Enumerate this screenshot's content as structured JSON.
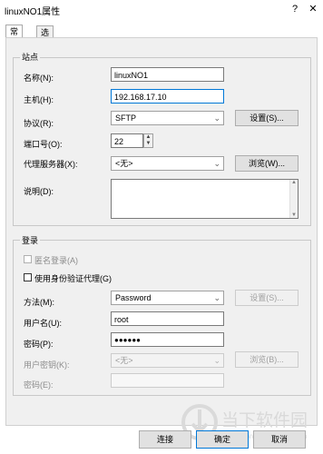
{
  "window": {
    "title": "linuxNO1属性",
    "help_glyph": "?",
    "close_glyph": "✕"
  },
  "tabs": [
    {
      "label": "常规"
    },
    {
      "label": "选项"
    }
  ],
  "station": {
    "group_title": "站点",
    "name_label": "名称(N):",
    "name_value": "linuxNO1",
    "host_label": "主机(H):",
    "host_value": "192.168.17.10",
    "protocol_label": "协议(R):",
    "protocol_value": "SFTP",
    "protocol_settings_button": "设置(S)...",
    "port_label": "端口号(O):",
    "port_value": "22",
    "proxy_label": "代理服务器(X):",
    "proxy_value": "<无>",
    "proxy_browse_button": "浏览(W)...",
    "description_label": "说明(D):",
    "description_value": ""
  },
  "login": {
    "group_title": "登录",
    "anonymous_label": "匿名登录(A)",
    "agent_label": "使用身份验证代理(G)",
    "method_label": "方法(M):",
    "method_value": "Password",
    "method_settings_button": "设置(S)...",
    "username_label": "用户名(U):",
    "username_value": "root",
    "password_label": "密码(P):",
    "password_value": "●●●●●●",
    "userkey_label": "用户密钥(K):",
    "userkey_value": "<无>",
    "userkey_browse_button": "浏览(B)...",
    "passphrase_label": "密码(E):",
    "passphrase_value": ""
  },
  "footer": {
    "connect_button": "连接",
    "ok_button": "确定",
    "cancel_button": "取消"
  },
  "watermark": {
    "text": "当下软件园",
    "url_text": "www.downxia.com"
  },
  "colors": {
    "focus_border": "#0078d7",
    "panel_bg": "#f0f0f0",
    "watermark": "#d9d9d9"
  }
}
